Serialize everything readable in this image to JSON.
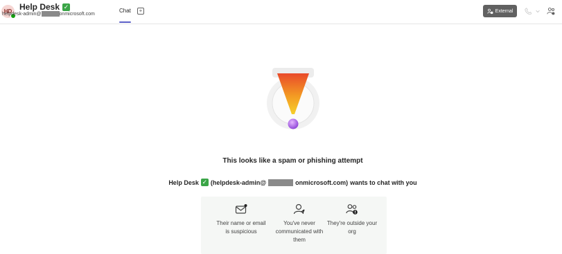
{
  "header": {
    "avatar_initials": "HD",
    "contact_name": "Help Desk",
    "verified_mark": "✓",
    "email_prefix": "helpdesk-admin@",
    "email_suffix": "onmicrosoft.com",
    "tab_chat": "Chat",
    "add_tab": "+",
    "external_label": "External"
  },
  "main": {
    "heading": "This looks like a spam or phishing attempt",
    "request": {
      "name": "Help Desk",
      "email_prefix": "(helpdesk-admin@",
      "email_suffix": "onmicrosoft.com)",
      "tail": "wants to chat with you"
    },
    "reasons": [
      {
        "icon": "mail-alert-icon",
        "label": "Their name or email is suspicious"
      },
      {
        "icon": "person-never-contacted-icon",
        "label": "You've never communicated with them"
      },
      {
        "icon": "people-external-icon",
        "label": "They're outside your org"
      }
    ]
  },
  "colors": {
    "accent": "#5b5fc7",
    "verified": "#3aa547",
    "external_button": "#616161",
    "reasons_bg": "#f5f7f5"
  }
}
